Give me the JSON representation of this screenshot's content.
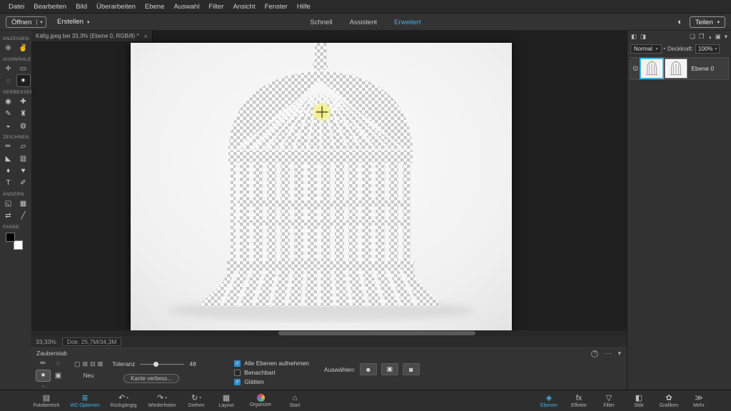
{
  "icons": {
    "caret": "▾"
  },
  "menubar": {
    "items": [
      "Datei",
      "Bearbeiten",
      "Bild",
      "Überarbeiten",
      "Ebene",
      "Auswahl",
      "Filter",
      "Ansicht",
      "Fenster",
      "Hilfe"
    ]
  },
  "topbar": {
    "open_label": "Öffnen",
    "create_label": "Erstellen",
    "tabs": [
      "Schnell",
      "Assistent",
      "Erweitert"
    ],
    "active_tab": "Erweitert",
    "moon_icon": "◐",
    "share_label": "Teilen"
  },
  "left_toolbar": {
    "sections": [
      {
        "label": "ANZEIGEN",
        "tools": [
          {
            "name": "zoom",
            "glyph": "⊕"
          },
          {
            "name": "hand",
            "glyph": "✌"
          }
        ]
      },
      {
        "label": "AUSWÄHLEN",
        "tools": [
          {
            "name": "move",
            "glyph": "✛"
          },
          {
            "name": "rectangular-marquee",
            "glyph": "▭"
          },
          {
            "name": "lasso",
            "glyph": "◌"
          },
          {
            "name": "magic-wand",
            "glyph": "✶",
            "selected": true
          }
        ]
      },
      {
        "label": "VERBESSERN",
        "tools": [
          {
            "name": "red-eye-removal",
            "glyph": "◉"
          },
          {
            "name": "spot-healing-brush",
            "glyph": "✚"
          },
          {
            "name": "smart-brush",
            "glyph": "✎"
          },
          {
            "name": "clone-stamp",
            "glyph": "♜"
          },
          {
            "name": "blur",
            "glyph": "◒"
          },
          {
            "name": "sponge",
            "glyph": "◍"
          }
        ]
      },
      {
        "label": "ZEICHNEN",
        "tools": [
          {
            "name": "brush",
            "glyph": "✏"
          },
          {
            "name": "eraser",
            "glyph": "▱"
          },
          {
            "name": "paint-bucket",
            "glyph": "◣"
          },
          {
            "name": "gradient",
            "glyph": "▥"
          },
          {
            "name": "eyedropper",
            "glyph": "♦"
          },
          {
            "name": "custom-shape",
            "glyph": "♥"
          },
          {
            "name": "type",
            "glyph": "T"
          },
          {
            "name": "pencil",
            "glyph": "✐"
          }
        ]
      },
      {
        "label": "ÄNDERN",
        "tools": [
          {
            "name": "crop",
            "glyph": "◱"
          },
          {
            "name": "recompose",
            "glyph": "▦"
          },
          {
            "name": "content-aware-move",
            "glyph": "⇄"
          },
          {
            "name": "straighten",
            "glyph": "╱"
          }
        ]
      },
      {
        "label": "FARBE",
        "tools": []
      }
    ]
  },
  "document": {
    "tab_title": "Käfig.jpeg bei 33,3% (Ebene 0, RGB/8) *",
    "close_icon": "×",
    "zoom_level": "33,33%",
    "doc_size": "Dok: 25,7M/34,3M"
  },
  "layers_panel": {
    "panel_icons": [
      {
        "name": "expand-panel",
        "glyph": "◧"
      },
      {
        "name": "collapse-panel",
        "glyph": "◨"
      },
      {
        "name": "new-layer",
        "glyph": "❏"
      },
      {
        "name": "new-group",
        "glyph": "❐"
      },
      {
        "name": "new-fill-layer",
        "glyph": "◑"
      },
      {
        "name": "lock",
        "glyph": "▣"
      },
      {
        "name": "panel-menu",
        "glyph": "▾"
      }
    ],
    "blend_mode": "Normal",
    "lock_icon": "▪",
    "opacity_label": "Deckkraft:",
    "opacity_value": "100%",
    "eye_icon": "⊙",
    "layer_name": "Ebene 0"
  },
  "tool_options": {
    "title": "Zauberstab",
    "help_icon": "?",
    "more_icon": "⋯",
    "collapse_icon": "▾",
    "variant_tools": [
      {
        "name": "selection-brush",
        "glyph": "✏"
      },
      {
        "name": "refine-selection-brush",
        "glyph": "◌"
      },
      {
        "name": "magic-wand",
        "glyph": "✶",
        "selected": true
      },
      {
        "name": "quick-selection",
        "glyph": "▣"
      },
      {
        "name": "auto-selection",
        "glyph": "◦"
      }
    ],
    "mode_icons": [
      {
        "name": "new-selection",
        "glyph": "▢"
      },
      {
        "name": "add-to-selection",
        "glyph": "⊞"
      },
      {
        "name": "subtract-from-selection",
        "glyph": "⊟"
      },
      {
        "name": "intersect-selection",
        "glyph": "⊠"
      }
    ],
    "mode_label": "Neu",
    "tolerance_label": "Toleranz",
    "tolerance_value": "48",
    "refine_edge_label": "Kante verbess...",
    "checkboxes": [
      {
        "label": "Alle Ebenen aufnehmen",
        "checked": true,
        "check_glyph": "✓"
      },
      {
        "label": "Benachbart",
        "checked": false
      },
      {
        "label": "Glätten",
        "checked": true,
        "check_glyph": "✓"
      }
    ],
    "select_label": "Auswählen:",
    "select_buttons": [
      {
        "name": "select-subject",
        "glyph": "☻"
      },
      {
        "name": "select-photo",
        "glyph": "▣"
      },
      {
        "name": "select-background",
        "glyph": "◙"
      }
    ]
  },
  "taskbar": {
    "left_items": [
      {
        "label": "Fotobereich",
        "glyph": "▤"
      },
      {
        "label": "WZ-Optionen",
        "glyph": "≣",
        "active": true
      },
      {
        "label": "Rückgängig",
        "glyph": "↶",
        "caret": "▾"
      },
      {
        "label": "Wiederholen",
        "glyph": "↷",
        "caret": "▾"
      },
      {
        "label": "Drehen",
        "glyph": "↻",
        "caret": "▾"
      },
      {
        "label": "Layout",
        "glyph": "▦"
      },
      {
        "label": "Organizer",
        "glyph": ""
      },
      {
        "label": "Start",
        "glyph": "⌂"
      }
    ],
    "right_items": [
      {
        "label": "Ebenen",
        "glyph": "◈",
        "active": true
      },
      {
        "label": "Effekte",
        "glyph": "fx"
      },
      {
        "label": "Filter",
        "glyph": "▽"
      },
      {
        "label": "Stile",
        "glyph": "◧"
      },
      {
        "label": "Grafiken",
        "glyph": "✿"
      },
      {
        "label": "Mehr",
        "glyph": "≫"
      }
    ]
  }
}
